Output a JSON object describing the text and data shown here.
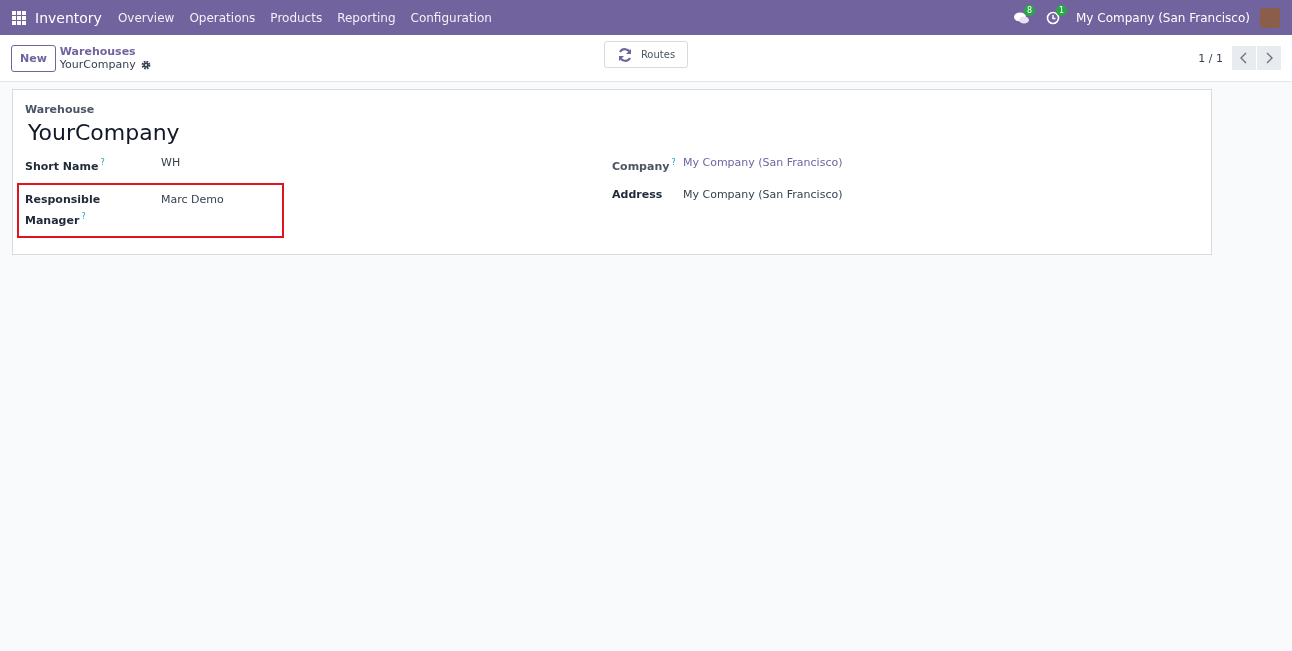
{
  "navbar": {
    "app": "Inventory",
    "menu": [
      "Overview",
      "Operations",
      "Products",
      "Reporting",
      "Configuration"
    ],
    "messages_count": "8",
    "activities_count": "1",
    "company": "My Company (San Francisco)"
  },
  "control_panel": {
    "new_button": "New",
    "breadcrumb": "Warehouses",
    "record": "YourCompany",
    "routes_button": "Routes",
    "pager": "1 / 1"
  },
  "form": {
    "title_label": "Warehouse",
    "title": "YourCompany",
    "left_fields": [
      {
        "label": "Short Name",
        "help": "?",
        "value": "WH",
        "kind": "text",
        "highlighted": false
      },
      {
        "label": "Responsible Manager",
        "help": "?",
        "value": "Marc Demo",
        "kind": "text",
        "highlighted": true
      }
    ],
    "right_fields": [
      {
        "label": "Company",
        "help": "?",
        "value": "My Company (San Francisco)",
        "kind": "link",
        "highlighted": false
      },
      {
        "label": "Address",
        "value": "My Company (San Francisco)",
        "kind": "text",
        "highlighted": false
      }
    ]
  }
}
